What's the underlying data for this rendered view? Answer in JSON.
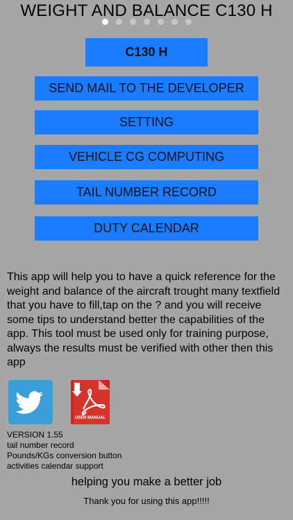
{
  "header": {
    "title": "WEIGHT AND BALANCE C130 H",
    "page_indicator": {
      "total": 7,
      "active_index": 0
    }
  },
  "buttons": {
    "model": "C130 H",
    "send_mail": "SEND MAIL TO THE DEVELOPER",
    "setting": "SETTING",
    "vehicle_cg": "VEHICLE  CG  COMPUTING",
    "tail_number": "TAIL NUMBER RECORD",
    "duty_calendar": "DUTY CALENDAR"
  },
  "description": "This app will help you to have a quick reference for the weight and balance of the aircraft trought many textfield that you have to fill,tap on the ? and you will receive some tips to understand better the capabilities of the app. This tool must be used only for training purpose, always the results must be verified with other then this app",
  "icons": {
    "twitter": "twitter-icon",
    "pdf": "pdf-user-manual-icon",
    "pdf_label": "USER MANUAL"
  },
  "version_info": {
    "version": "VERSION 1.55",
    "lines": [
      "tail number record",
      "Pounds/KGs conversion button",
      "activities calendar support"
    ]
  },
  "footer": {
    "slogan": "helping you make a better job",
    "thanks": "Thank you for using this app!!!!!"
  },
  "colors": {
    "background": "#a6a6a6",
    "button": "#1a7cff",
    "twitter": "#3a9edb",
    "pdf": "#c72a24"
  }
}
